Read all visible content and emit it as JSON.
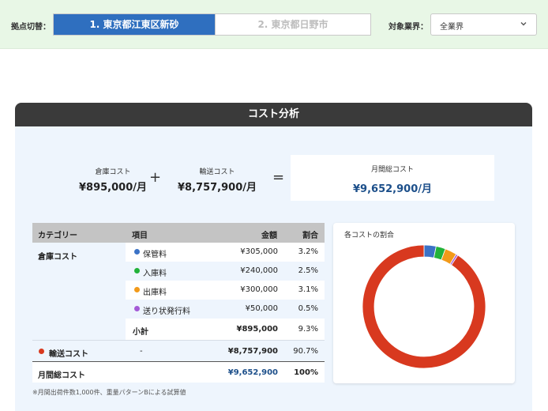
{
  "header": {
    "site_label": "拠点切替：",
    "tabs": [
      {
        "label": "1. 東京都江東区新砂",
        "active": true
      },
      {
        "label": "2. 東京都日野市",
        "active": false
      }
    ],
    "industry_label": "対象業界：",
    "industry_value": "全業界"
  },
  "panel": {
    "title": "コスト分析",
    "summary": {
      "warehouse_label": "倉庫コスト",
      "warehouse_value": "¥895,000/月",
      "plus": "+",
      "shipping_label": "輸送コスト",
      "shipping_value": "¥8,757,900/月",
      "equals": "=",
      "total_label": "月間総コスト",
      "total_value": "¥9,652,900/月"
    },
    "table": {
      "headers": {
        "category": "カテゴリー",
        "item": "項目",
        "amount": "金額",
        "ratio": "割合"
      },
      "warehouse_category": "倉庫コスト",
      "warehouse_items": [
        {
          "name": "保管料",
          "amount": "¥305,000",
          "ratio": "3.2%",
          "color": "#3b72c6"
        },
        {
          "name": "入庫料",
          "amount": "¥240,000",
          "ratio": "2.5%",
          "color": "#22b23a"
        },
        {
          "name": "出庫料",
          "amount": "¥300,000",
          "ratio": "3.1%",
          "color": "#f29a1a"
        },
        {
          "name": "送り状発行料",
          "amount": "¥50,000",
          "ratio": "0.5%",
          "color": "#a45ad6"
        }
      ],
      "subtotal": {
        "label": "小計",
        "amount": "¥895,000",
        "ratio": "9.3%"
      },
      "shipping": {
        "label": "輸送コスト",
        "item": "-",
        "amount": "¥8,757,900",
        "ratio": "90.7%",
        "color": "#d8391f"
      },
      "total": {
        "label": "月間総コスト",
        "amount": "¥9,652,900",
        "ratio": "100%"
      }
    },
    "note": "※月間出荷件数1,000件、重量パターンBによる試算値"
  },
  "chart_data": {
    "type": "pie",
    "title": "各コストの割合",
    "categories": [
      "保管料",
      "入庫料",
      "出庫料",
      "送り状発行料",
      "輸送コスト"
    ],
    "values": [
      305000,
      240000,
      300000,
      50000,
      8757900
    ],
    "colors": [
      "#3b72c6",
      "#22b23a",
      "#f29a1a",
      "#a45ad6",
      "#d8391f"
    ],
    "donut": true
  }
}
